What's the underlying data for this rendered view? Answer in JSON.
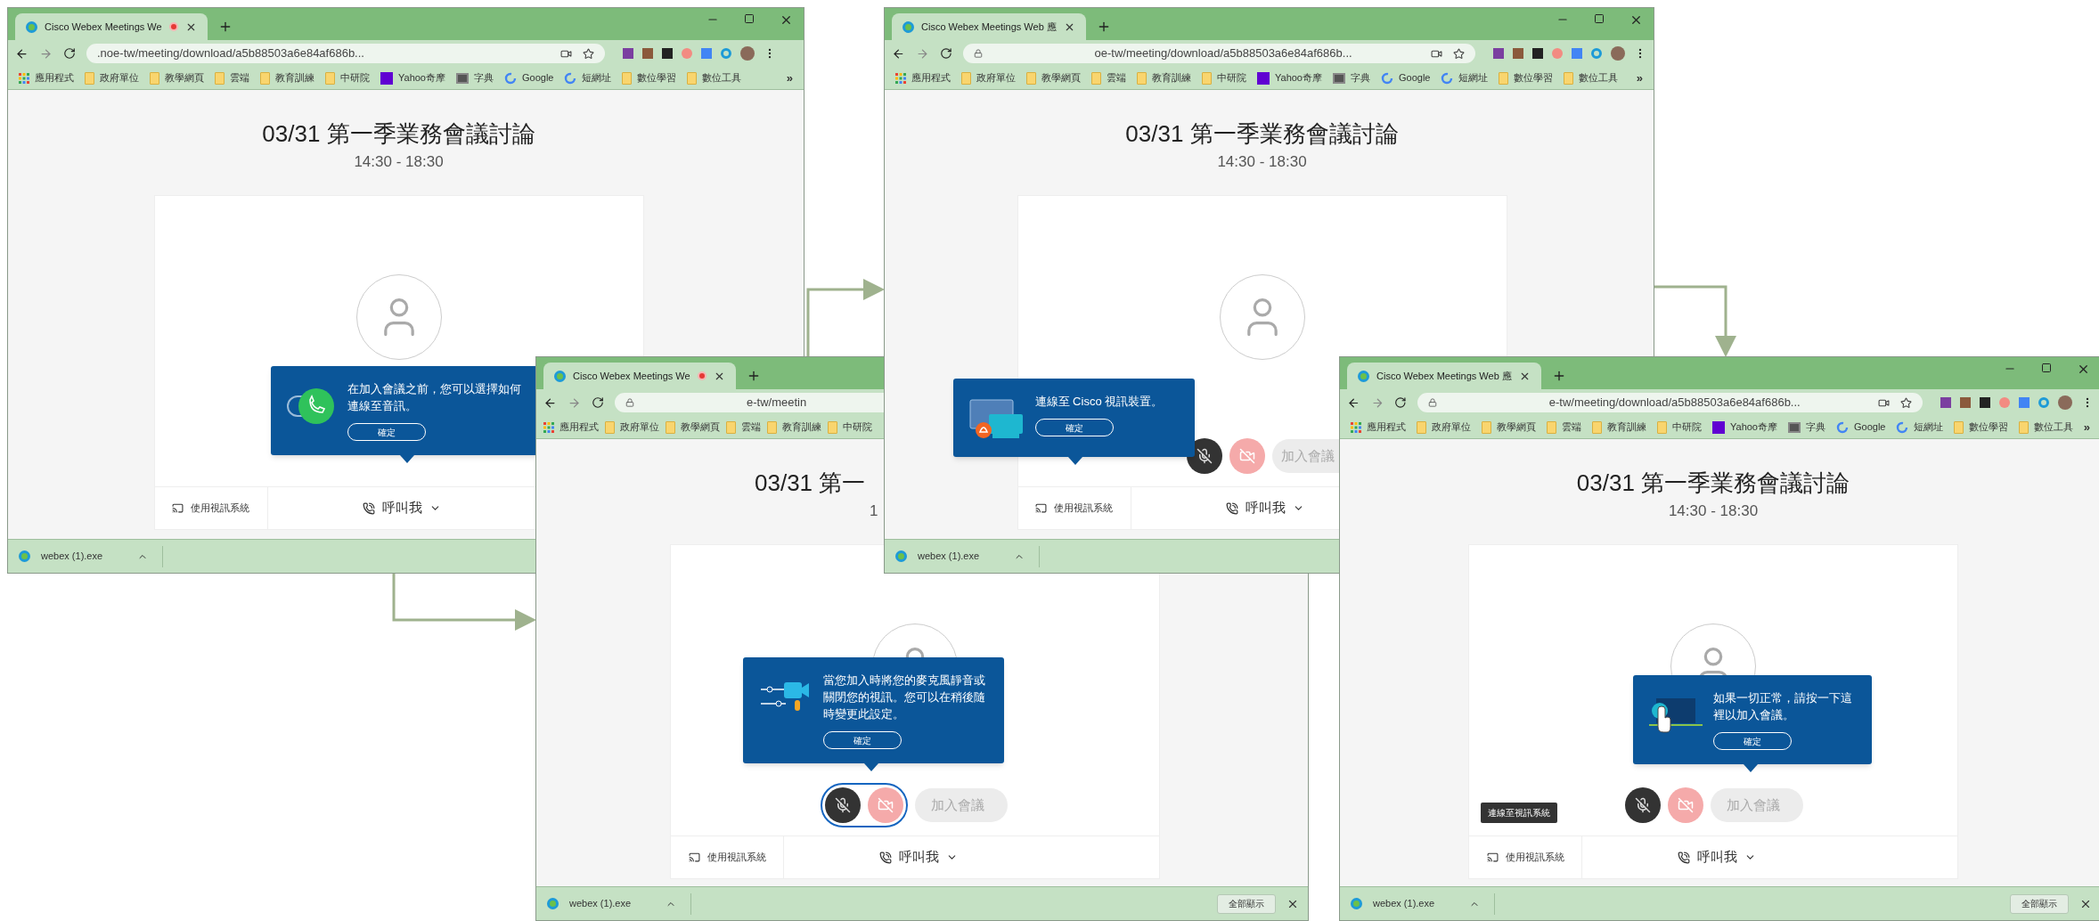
{
  "windows": [
    {
      "tab": {
        "title": "Cisco Webex Meetings We",
        "recording": true
      },
      "url": ".noe-tw/meeting/download/a5b88503a6e84af686b...",
      "bookmarks": [
        {
          "kind": "apps",
          "label": "應用程式"
        },
        {
          "kind": "folder",
          "label": "政府單位"
        },
        {
          "kind": "folder",
          "label": "教學網頁"
        },
        {
          "kind": "folder",
          "label": "雲端"
        },
        {
          "kind": "folder",
          "label": "教育訓練"
        },
        {
          "kind": "folder",
          "label": "中研院"
        },
        {
          "kind": "yahoo",
          "label": "Yahoo奇摩"
        },
        {
          "kind": "book",
          "label": "字典"
        },
        {
          "kind": "google",
          "label": "Google"
        },
        {
          "kind": "google",
          "label": "短網址"
        },
        {
          "kind": "folder",
          "label": "數位學習"
        },
        {
          "kind": "folder",
          "label": "數位工具"
        }
      ],
      "bookmarks_more": "»",
      "title": "03/31 第一季業務會議討論",
      "time": "14:30 - 18:30",
      "popup": {
        "kind": "audio",
        "text": "在加入會議之前，您可以選擇如何連線至音訊。",
        "button": "確定"
      },
      "bottom": {
        "video_system": "使用視訊系統",
        "call_me": "呼叫我"
      },
      "download": {
        "file": "webex (1).exe"
      }
    },
    {
      "tab": {
        "title": "Cisco Webex Meetings We",
        "recording": true
      },
      "url": "e-tw/meetin",
      "bookmarks": [
        {
          "kind": "apps",
          "label": "應用程式"
        },
        {
          "kind": "folder",
          "label": "政府單位"
        },
        {
          "kind": "folder",
          "label": "教學網頁"
        },
        {
          "kind": "folder",
          "label": "雲端"
        },
        {
          "kind": "folder",
          "label": "教育訓練"
        },
        {
          "kind": "folder",
          "label": "中研院"
        }
      ],
      "title": "03/31 第一",
      "time": "1",
      "popup": {
        "kind": "mute",
        "text": "當您加入時將您的麥克風靜音或關閉您的視訊。您可以在稍後隨時變更此設定。",
        "button": "確定"
      },
      "controls": {
        "highlighted": true,
        "join": "加入會議"
      },
      "bottom": {
        "video_system": "使用視訊系統",
        "call_me": "呼叫我"
      },
      "download": {
        "file": "webex (1).exe",
        "show_all": "全部顯示"
      }
    },
    {
      "tab": {
        "title": "Cisco Webex Meetings Web 應",
        "recording": false
      },
      "url": "oe-tw/meeting/download/a5b88503a6e84af686b...",
      "bookmarks": [
        {
          "kind": "apps",
          "label": "應用程式"
        },
        {
          "kind": "folder",
          "label": "政府單位"
        },
        {
          "kind": "folder",
          "label": "教學網頁"
        },
        {
          "kind": "folder",
          "label": "雲端"
        },
        {
          "kind": "folder",
          "label": "教育訓練"
        },
        {
          "kind": "folder",
          "label": "中研院"
        },
        {
          "kind": "yahoo",
          "label": "Yahoo奇摩"
        },
        {
          "kind": "book",
          "label": "字典"
        },
        {
          "kind": "google",
          "label": "Google"
        },
        {
          "kind": "google",
          "label": "短網址"
        },
        {
          "kind": "folder",
          "label": "數位學習"
        },
        {
          "kind": "folder",
          "label": "數位工具"
        }
      ],
      "bookmarks_more": "»",
      "title": "03/31 第一季業務會議討論",
      "time": "14:30 - 18:30",
      "popup": {
        "kind": "video_device",
        "text": "連線至 Cisco 視訊裝置。",
        "button": "確定"
      },
      "controls": {
        "highlighted": false,
        "join": "加入會議"
      },
      "bottom": {
        "video_system": "使用視訊系統",
        "call_me": "呼叫我"
      },
      "download": {
        "file": "webex (1).exe"
      }
    },
    {
      "tab": {
        "title": "Cisco Webex Meetings Web 應",
        "recording": false
      },
      "url": "e-tw/meeting/download/a5b88503a6e84af686b...",
      "bookmarks": [
        {
          "kind": "apps",
          "label": "應用程式"
        },
        {
          "kind": "folder",
          "label": "政府單位"
        },
        {
          "kind": "folder",
          "label": "教學網頁"
        },
        {
          "kind": "folder",
          "label": "雲端"
        },
        {
          "kind": "folder",
          "label": "教育訓練"
        },
        {
          "kind": "folder",
          "label": "中研院"
        },
        {
          "kind": "yahoo",
          "label": "Yahoo奇摩"
        },
        {
          "kind": "book",
          "label": "字典"
        },
        {
          "kind": "google",
          "label": "Google"
        },
        {
          "kind": "google",
          "label": "短網址"
        },
        {
          "kind": "folder",
          "label": "數位學習"
        },
        {
          "kind": "folder",
          "label": "數位工具"
        }
      ],
      "bookmarks_more": "»",
      "title": "03/31 第一季業務會議討論",
      "time": "14:30 - 18:30",
      "popup": {
        "kind": "join",
        "text": "如果一切正常，請按一下這裡以加入會議。",
        "button": "確定"
      },
      "controls": {
        "highlighted": false,
        "join": "加入會議"
      },
      "tooltip": "連線至視訊系統",
      "bottom": {
        "video_system": "使用視訊系統",
        "call_me": "呼叫我"
      },
      "download": {
        "file": "webex (1).exe",
        "show_all": "全部顯示"
      }
    }
  ]
}
